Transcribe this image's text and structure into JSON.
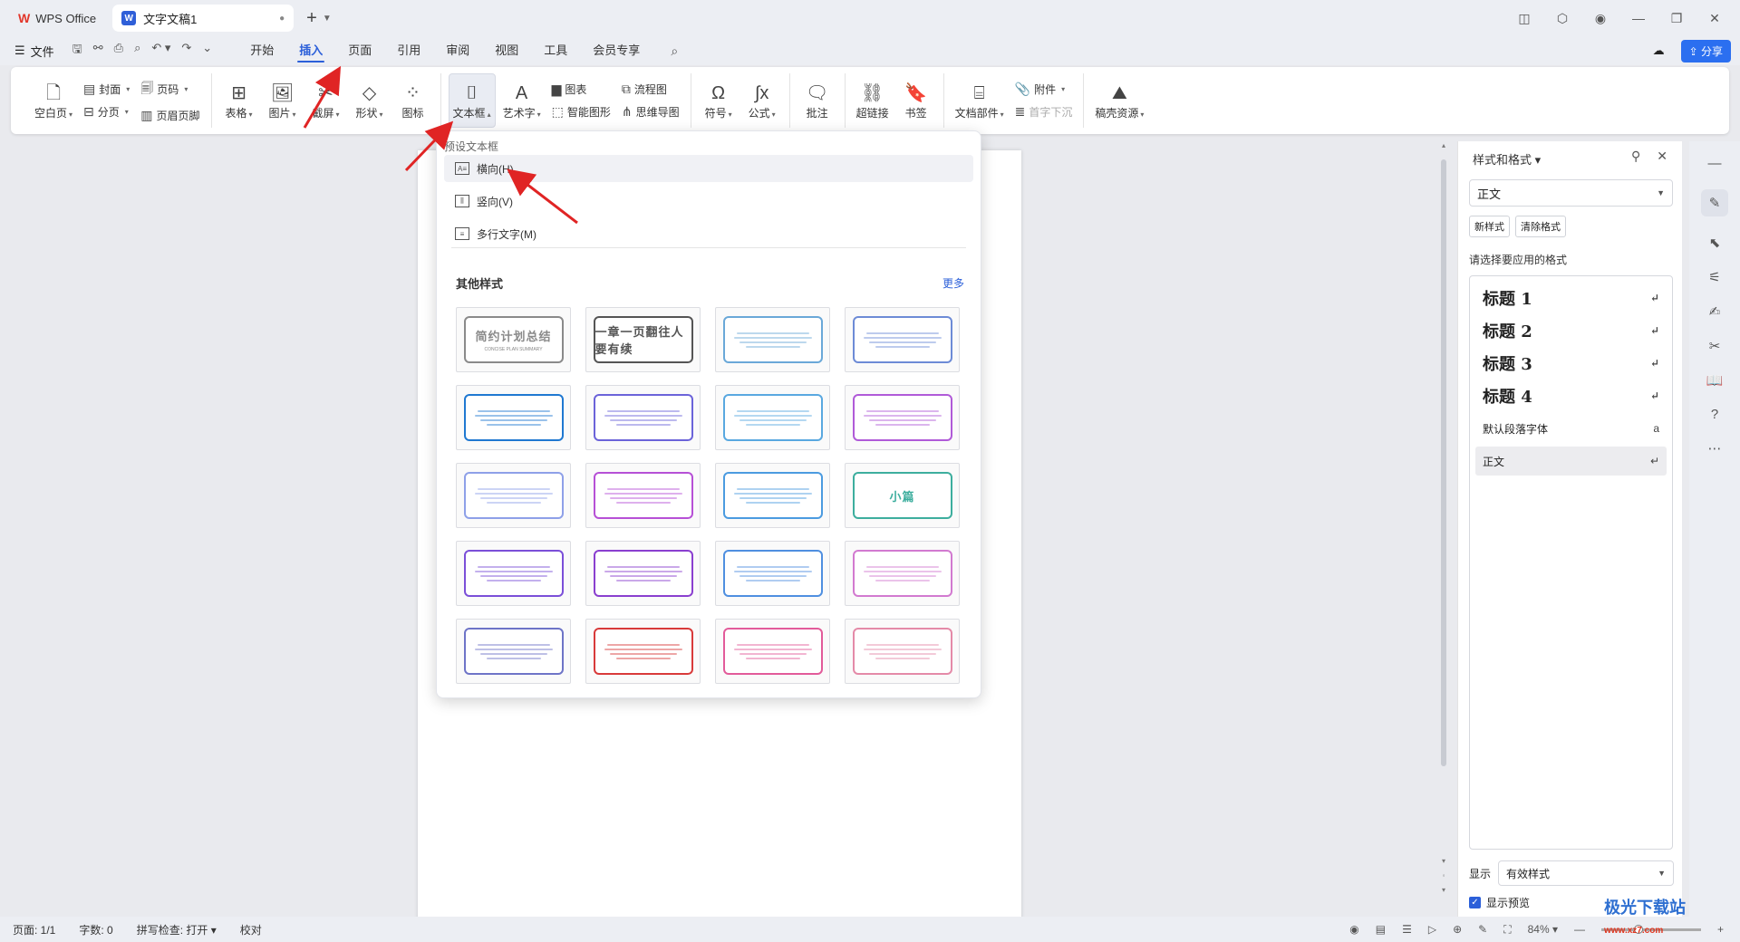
{
  "titlebar": {
    "app_tab": "WPS Office",
    "doc_tab": "文字文稿1",
    "doc_badge": "W"
  },
  "menubar": {
    "file_label": "文件",
    "tabs": [
      "开始",
      "插入",
      "页面",
      "引用",
      "审阅",
      "视图",
      "工具",
      "会员专享"
    ],
    "active_tab": "插入",
    "share_label": "分享"
  },
  "ribbon": {
    "blank_page": "空白页",
    "cover": "封面",
    "page_break": "分页",
    "page_number": "页码",
    "header_footer": "页眉页脚",
    "table": "表格",
    "picture": "图片",
    "screenshot": "截屏",
    "shape": "形状",
    "icon": "图标",
    "textbox": "文本框",
    "wordart": "艺术字",
    "chart": "图表",
    "smart_graphic": "智能图形",
    "flowchart": "流程图",
    "mindmap": "思维导图",
    "symbol": "符号",
    "formula": "公式",
    "comment": "批注",
    "hyperlink": "超链接",
    "bookmark": "书签",
    "doc_parts": "文档部件",
    "attachment": "附件",
    "drop_cap": "首字下沉",
    "resources": "稿壳资源"
  },
  "dropdown": {
    "preset_title": "预设文本框",
    "horizontal": "横向(H)",
    "vertical": "竖向(V)",
    "multiline": "多行文字(M)",
    "other_styles": "其他样式",
    "more": "更多",
    "templates": [
      {
        "text": "简约计划总结",
        "sub": "CONCISE PLAN SUMMARY",
        "color": "#8a8a8a"
      },
      {
        "text": "一章一页翻往人要有续",
        "sub": "",
        "color": "#555555"
      },
      {
        "text": "",
        "sub": "",
        "color": "#6aa8d8"
      },
      {
        "text": "",
        "sub": "",
        "color": "#6d8bd6"
      },
      {
        "text": "",
        "sub": "",
        "color": "#1f78d1"
      },
      {
        "text": "",
        "sub": "",
        "color": "#6b63d9"
      },
      {
        "text": "",
        "sub": "",
        "color": "#59a8e0"
      },
      {
        "text": "",
        "sub": "",
        "color": "#b05ad8"
      },
      {
        "text": "",
        "sub": "",
        "color": "#8ea0e8"
      },
      {
        "text": "",
        "sub": "",
        "color": "#b650d6"
      },
      {
        "text": "",
        "sub": "",
        "color": "#4b9be0"
      },
      {
        "text": "小篇",
        "sub": "",
        "color": "#3dae9e"
      },
      {
        "text": "",
        "sub": "",
        "color": "#7b4fd8"
      },
      {
        "text": "",
        "sub": "",
        "color": "#8a3fcf"
      },
      {
        "text": "",
        "sub": "",
        "color": "#4f8fe0"
      },
      {
        "text": "",
        "sub": "",
        "color": "#d27ad0"
      },
      {
        "text": "",
        "sub": "",
        "color": "#6e74c7"
      },
      {
        "text": "",
        "sub": "",
        "color": "#d83a3a"
      },
      {
        "text": "",
        "sub": "",
        "color": "#e25b9a"
      },
      {
        "text": "",
        "sub": "",
        "color": "#e48aa8"
      }
    ]
  },
  "right_panel": {
    "title": "样式和格式",
    "current_style": "正文",
    "new_style": "新样式",
    "clear_format": "清除格式",
    "apply_label": "请选择要应用的格式",
    "styles": [
      {
        "name": "标题  1",
        "mark": "↵",
        "heading": true
      },
      {
        "name": "标题  2",
        "mark": "↵",
        "heading": true
      },
      {
        "name": "标题  3",
        "mark": "↵",
        "heading": true
      },
      {
        "name": "标题  4",
        "mark": "↵",
        "heading": true
      },
      {
        "name": "默认段落字体",
        "mark": "a",
        "heading": false
      },
      {
        "name": "正文",
        "mark": "↵",
        "heading": false
      }
    ],
    "show_label": "显示",
    "show_value": "有效样式",
    "preview_label": "显示预览"
  },
  "statusbar": {
    "page": "页面: 1/1",
    "words": "字数: 0",
    "spell": "拼写检查: 打开",
    "proof": "校对",
    "zoom": "84%"
  },
  "watermark": {
    "text": "极光下载站",
    "url_text": "www.xz7.com"
  }
}
